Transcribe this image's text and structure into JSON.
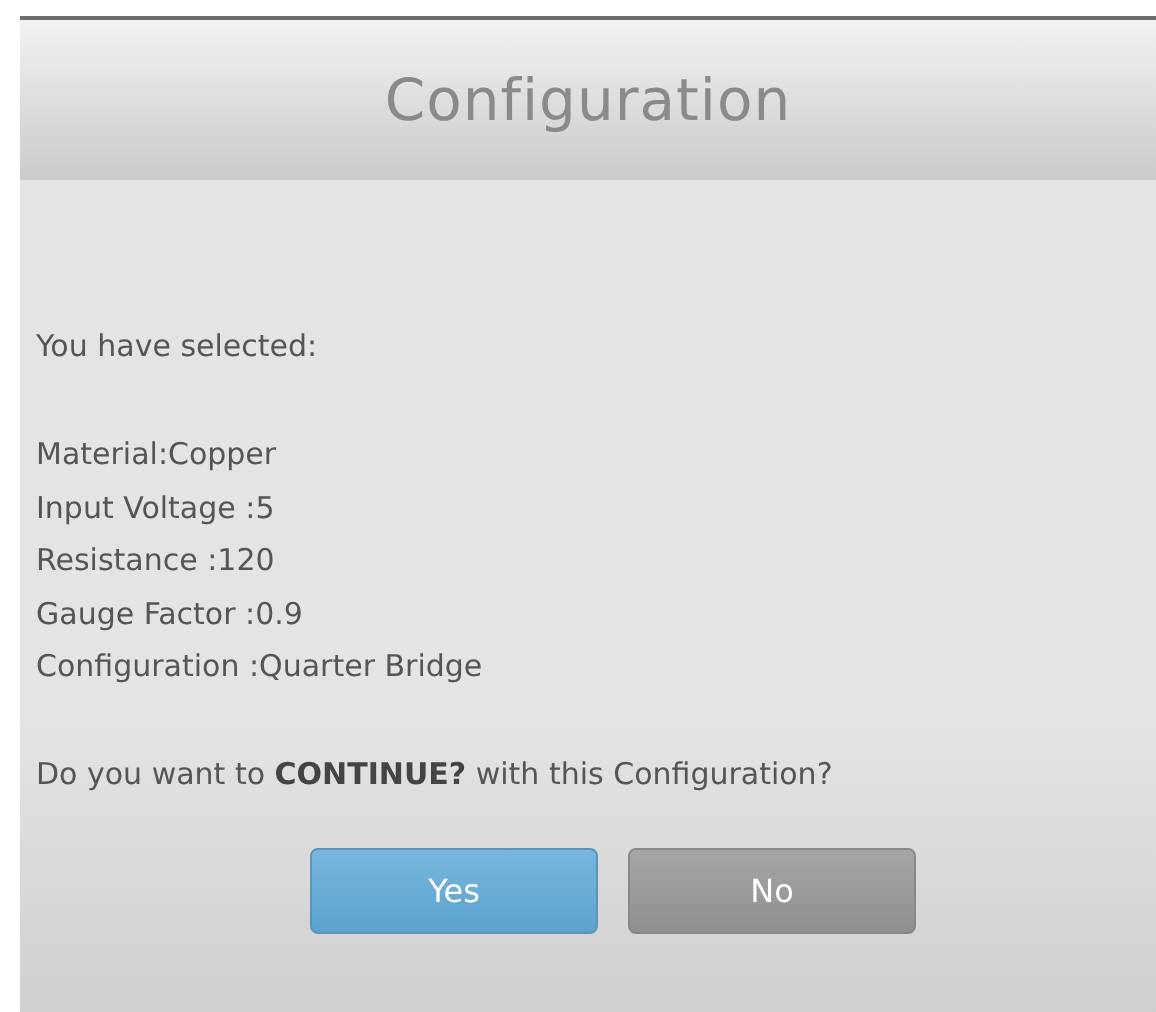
{
  "dialog": {
    "title": "Configuration",
    "intro": "You have selected:",
    "details": [
      "Material:Copper",
      "Input Voltage :5",
      "Resistance :120",
      "Gauge Factor :0.9",
      "Configuration :Quarter Bridge"
    ],
    "question": "Do you want to **CONTINUE?** with this Configuration?",
    "buttons": [
      {
        "label": "Yes",
        "kind": "primary"
      },
      {
        "label": "No",
        "kind": "secondary"
      }
    ]
  }
}
